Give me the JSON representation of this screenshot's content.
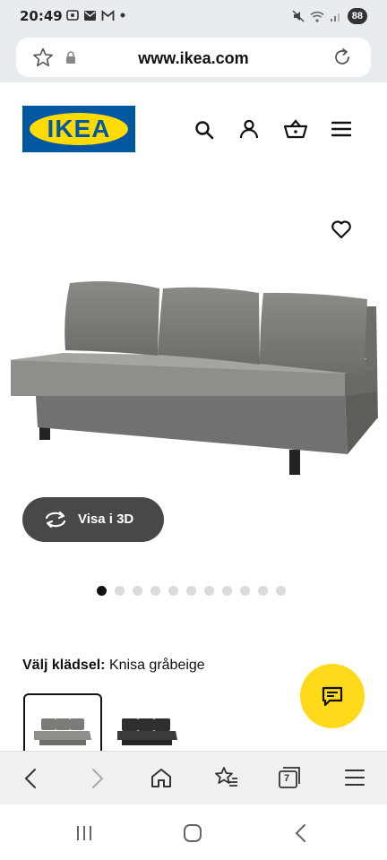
{
  "status_bar": {
    "time": "20:49",
    "battery": "88"
  },
  "browser": {
    "url": "www.ikea.com"
  },
  "brand": {
    "logo_text": "IKEA"
  },
  "product": {
    "view_3d_label": "Visa i 3D",
    "fabric_label": "Välj klädsel:",
    "fabric_value": "Knisa gråbeige",
    "image_count": 11,
    "active_image": 1
  },
  "colors": {
    "ikea_blue": "#0058a3",
    "ikea_yellow": "#ffdb00",
    "chat_yellow": "#ffda1a",
    "button_dark": "#484848"
  },
  "icons": [
    "star-icon",
    "lock-icon",
    "reload-icon",
    "search-icon",
    "account-icon",
    "basket-icon",
    "hamburger-menu-icon",
    "heart-icon",
    "rotate-3d-icon",
    "chat-icon",
    "back-icon",
    "forward-icon",
    "home-icon",
    "bookmarks-icon",
    "tabs-icon",
    "menu-icon"
  ],
  "browser_nav": {
    "tabs_count": "7"
  }
}
